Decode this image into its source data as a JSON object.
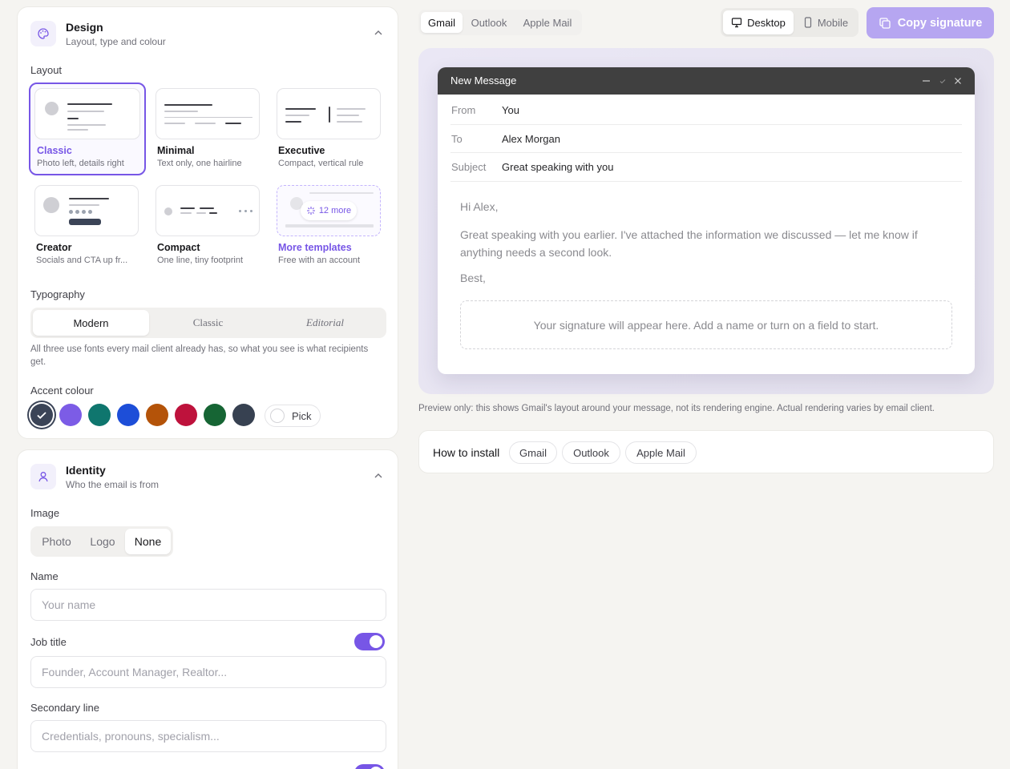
{
  "design": {
    "title": "Design",
    "subtitle": "Layout, type and colour",
    "layout_label": "Layout",
    "layouts": [
      {
        "name": "Classic",
        "desc": "Photo left, details right"
      },
      {
        "name": "Minimal",
        "desc": "Text only, one hairline"
      },
      {
        "name": "Executive",
        "desc": "Compact, vertical rule"
      },
      {
        "name": "Creator",
        "desc": "Socials and CTA up fr..."
      },
      {
        "name": "Compact",
        "desc": "One line, tiny footprint"
      },
      {
        "name": "More templates",
        "desc": "Free with an account",
        "badge": "12 more"
      }
    ],
    "selected_layout": "Classic",
    "typography_label": "Typography",
    "typography_options": [
      "Modern",
      "Classic",
      "Editorial"
    ],
    "typography_selected": "Modern",
    "typography_note": "All three use fonts every mail client already has, so what you see is what recipients get.",
    "accent_label": "Accent colour",
    "accent_colors": [
      "#3b4457",
      "#7c5ce6",
      "#0f766e",
      "#1d4ed8",
      "#b45309",
      "#be123c",
      "#166534",
      "#374151"
    ],
    "accent_selected": "#3b4457",
    "pick_label": "Pick"
  },
  "identity": {
    "title": "Identity",
    "subtitle": "Who the email is from",
    "image_label": "Image",
    "image_options": [
      "Photo",
      "Logo",
      "None"
    ],
    "image_selected": "None",
    "name_label": "Name",
    "name_placeholder": "Your name",
    "job_label": "Job title",
    "job_placeholder": "Founder, Account Manager, Realtor...",
    "job_enabled": true,
    "secondary_label": "Secondary line",
    "secondary_placeholder": "Credentials, pronouns, specialism...",
    "secondary_enabled": true
  },
  "preview": {
    "client_tabs": [
      "Gmail",
      "Outlook",
      "Apple Mail"
    ],
    "client_selected": "Gmail",
    "device_tabs": [
      "Desktop",
      "Mobile"
    ],
    "device_selected": "Desktop",
    "copy_label": "Copy signature",
    "window_title": "New Message",
    "fields": [
      {
        "label": "From",
        "value": "You"
      },
      {
        "label": "To",
        "value": "Alex Morgan"
      },
      {
        "label": "Subject",
        "value": "Great speaking with you"
      }
    ],
    "greeting": "Hi Alex,",
    "body": "Great speaking with you earlier. I've attached the information we discussed — let me know if anything needs a second look.",
    "closing": "Best,",
    "signature_placeholder": "Your signature will appear here. Add a name or turn on a field to start.",
    "note": "Preview only: this shows Gmail's layout around your message, not its rendering engine. Actual rendering varies by email client."
  },
  "install": {
    "label": "How to install",
    "options": [
      "Gmail",
      "Outlook",
      "Apple Mail"
    ]
  },
  "colors": {
    "accent": "#7756e6",
    "copy_button": "#b6a6f1",
    "window_bar": "#404040"
  }
}
